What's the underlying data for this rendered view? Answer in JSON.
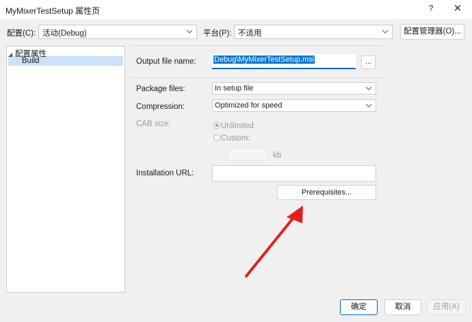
{
  "window": {
    "title": "MyMixerTestSetup 属性页",
    "help": "?",
    "close": "✕"
  },
  "toolbar": {
    "config_label": "配置(C):",
    "config_value": "活动(Debug)",
    "platform_label": "平台(P):",
    "platform_value": "不适用",
    "config_manager_button": "配置管理器(O)..."
  },
  "tree": {
    "root_label": "配置属性",
    "child_label": "Build"
  },
  "form": {
    "output_label": "Output file name:",
    "output_value": "Debug\\MyMixerTestSetup.msi",
    "browse_button": "...",
    "package_label": "Package files:",
    "package_value": "In setup file",
    "compression_label": "Compression:",
    "compression_value": "Optimized for speed",
    "cab_label": "CAB size:",
    "cab_unlimited": "Unlimited",
    "cab_custom": "Custom:",
    "cab_unit": "kb",
    "install_url_label": "Installation URL:",
    "install_url_value": "",
    "prerequisites_button": "Prerequisites..."
  },
  "footer": {
    "ok": "确定",
    "cancel": "取消",
    "apply": "应用(A)"
  },
  "colors": {
    "accent": "#0067c0",
    "selection": "#0078d7",
    "arrow": "#e0201c"
  }
}
